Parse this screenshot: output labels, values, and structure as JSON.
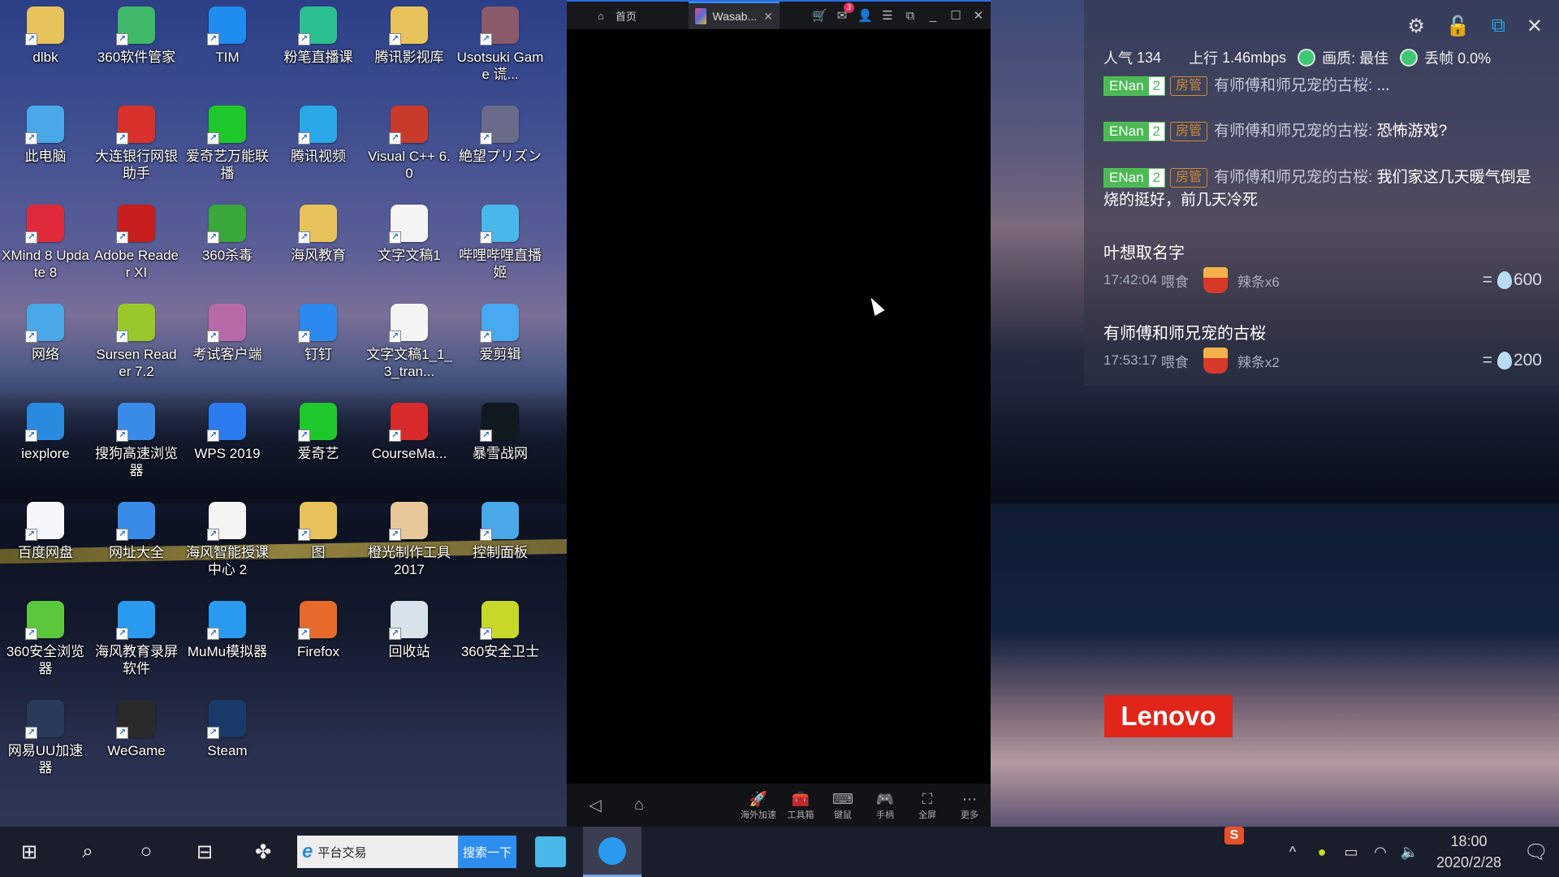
{
  "desktop": {
    "icons": [
      {
        "label": "dlbk",
        "icon": "user-folder-icon",
        "color": "#e8c25a"
      },
      {
        "label": "360软件管家",
        "icon": "360-software-manager-icon",
        "color": "#3fb86a"
      },
      {
        "label": "TIM",
        "icon": "tim-icon",
        "color": "#1f8cf0"
      },
      {
        "label": "粉笔直播课",
        "icon": "fenbi-icon",
        "color": "#2cbf8f"
      },
      {
        "label": "腾讯影视库",
        "icon": "tencent-video-library-icon",
        "color": "#e8c25a"
      },
      {
        "label": "Usotsuki Game 谎...",
        "icon": "usotsuki-game-icon",
        "color": "#8a5a6a"
      },
      {
        "label": "此电脑",
        "icon": "this-pc-icon",
        "color": "#48a8e8"
      },
      {
        "label": "大连银行网银助手",
        "icon": "dalian-bank-icon",
        "color": "#d8302a"
      },
      {
        "label": "爱奇艺万能联播",
        "icon": "iqiyi-lianbo-icon",
        "color": "#1fc82a"
      },
      {
        "label": "腾讯视频",
        "icon": "tencent-video-icon",
        "color": "#2aa8e8"
      },
      {
        "label": "Visual C++ 6.0",
        "icon": "visual-cpp-icon",
        "color": "#c83a2a"
      },
      {
        "label": "絶望プリズン",
        "icon": "zetsubou-prison-icon",
        "color": "#6a6a8a"
      },
      {
        "label": "XMind 8 Update 8",
        "icon": "xmind-icon",
        "color": "#e02a3a"
      },
      {
        "label": "Adobe Reader XI",
        "icon": "adobe-reader-icon",
        "color": "#c81e1e"
      },
      {
        "label": "360杀毒",
        "icon": "360-antivirus-icon",
        "color": "#3aa83a"
      },
      {
        "label": "海风教育",
        "icon": "folder-icon",
        "color": "#e8c25a"
      },
      {
        "label": "文字文稿1",
        "icon": "wps-document-icon",
        "color": "#f4f4f4"
      },
      {
        "label": "哔哩哔哩直播姬",
        "icon": "bilibili-live-icon",
        "color": "#48b8e8"
      },
      {
        "label": "网络",
        "icon": "network-icon",
        "color": "#48a8e8"
      },
      {
        "label": "Sursen Reader 7.2",
        "icon": "sursen-reader-icon",
        "color": "#9ac82a"
      },
      {
        "label": "考试客户端",
        "icon": "exam-client-icon",
        "color": "#b86aa8"
      },
      {
        "label": "钉钉",
        "icon": "dingtalk-icon",
        "color": "#2a8af0"
      },
      {
        "label": "文字文稿1_1_3_tran...",
        "icon": "wps-document-icon",
        "color": "#f4f4f4"
      },
      {
        "label": "爱剪辑",
        "icon": "aijianji-icon",
        "color": "#48a8f0"
      },
      {
        "label": "iexplore",
        "icon": "internet-explorer-icon",
        "color": "#2a8ae0"
      },
      {
        "label": "搜狗高速浏览器",
        "icon": "sogou-browser-icon",
        "color": "#3a8ae8"
      },
      {
        "label": "WPS 2019",
        "icon": "wps-icon",
        "color": "#2a7af0"
      },
      {
        "label": "爱奇艺",
        "icon": "iqiyi-icon",
        "color": "#1fc82a"
      },
      {
        "label": "CourseMa...",
        "icon": "coursemaker-icon",
        "color": "#d82a2a"
      },
      {
        "label": "暴雪战网",
        "icon": "battle-net-icon",
        "color": "#101820"
      },
      {
        "label": "百度网盘",
        "icon": "baidu-netdisk-icon",
        "color": "#f4f8fc"
      },
      {
        "label": "网址大全",
        "icon": "url-navigator-icon",
        "color": "#3a8ae8"
      },
      {
        "label": "海风智能授课中心 2",
        "icon": "blank-file-icon",
        "color": "#f4f4f4"
      },
      {
        "label": "图",
        "icon": "folder-icon",
        "color": "#e8c25a"
      },
      {
        "label": "橙光制作工具2017",
        "icon": "orange-light-tool-icon",
        "color": "#e8c89a"
      },
      {
        "label": "控制面板",
        "icon": "control-panel-icon",
        "color": "#48a8e8"
      },
      {
        "label": "360安全浏览器",
        "icon": "360-browser-icon",
        "color": "#5ac83a"
      },
      {
        "label": "海风教育录屏软件",
        "icon": "screen-recorder-icon",
        "color": "#2a9af0"
      },
      {
        "label": "MuMu模拟器",
        "icon": "mumu-emulator-icon",
        "color": "#2a9af0"
      },
      {
        "label": "Firefox",
        "icon": "firefox-icon",
        "color": "#e86a2a"
      },
      {
        "label": "回收站",
        "icon": "recycle-bin-icon",
        "color": "#d8e4ec"
      },
      {
        "label": "360安全卫士",
        "icon": "360-security-icon",
        "color": "#c8d82a"
      },
      {
        "label": "网易UU加速器",
        "icon": "uu-accelerator-icon",
        "color": "#2a3a5a"
      },
      {
        "label": "WeGame",
        "icon": "wegame-icon",
        "color": "#2a2a2a"
      },
      {
        "label": "Steam",
        "icon": "steam-icon",
        "color": "#1a3a6a"
      }
    ]
  },
  "emulator": {
    "home_tab": "首页",
    "active_tab": "Wasab...",
    "mail_badge": "3",
    "nav": {
      "back": "◁",
      "home": "⌂"
    },
    "tools": [
      {
        "label": "海外加速",
        "icon": "rocket-icon",
        "glyph": "🚀"
      },
      {
        "label": "工具箱",
        "icon": "toolbox-icon",
        "glyph": "🧰"
      },
      {
        "label": "键鼠",
        "icon": "keyboard-icon",
        "glyph": "⌨"
      },
      {
        "label": "手柄",
        "icon": "gamepad-icon",
        "glyph": "🎮"
      },
      {
        "label": "全屏",
        "icon": "fullscreen-icon",
        "glyph": "⛶"
      },
      {
        "label": "更多",
        "icon": "more-icon",
        "glyph": "⋯"
      }
    ]
  },
  "live_panel": {
    "stats": {
      "popularity_label": "人气",
      "popularity": "134",
      "upload_label": "上行",
      "upload": "1.46mbps",
      "quality": "画质: 最佳",
      "dropped": "丢帧 0.0%",
      "status_color": "#3ec876"
    },
    "chat": [
      {
        "medal": "ENan",
        "level": "2",
        "role": "房管",
        "user": "有师傅和师兄宠的古桜:",
        "text": "..."
      },
      {
        "medal": "ENan",
        "level": "2",
        "role": "房管",
        "user": "有师傅和师兄宠的古桜:",
        "text": "恐怖游戏?"
      },
      {
        "medal": "ENan",
        "level": "2",
        "role": "房管",
        "user": "有师傅和师兄宠的古桜:",
        "text": "我们家这几天暖气倒是烧的挺好，前几天冷死"
      }
    ],
    "gifts": [
      {
        "user": "叶想取名字",
        "time": "17:42:04",
        "action": "喂食",
        "gift": "辣条x6",
        "value": "600"
      },
      {
        "user": "有师傅和师兄宠的古桜",
        "time": "17:53:17",
        "action": "喂食",
        "gift": "辣条x2",
        "value": "200"
      }
    ],
    "equals": "="
  },
  "wallpaper": {
    "brand": "Lenovo",
    "brand_color": "#e1251b"
  },
  "taskbar": {
    "search_text": "平台交易",
    "search_button": "搜索一下",
    "time": "18:00",
    "date": "2020/2/28",
    "ime": "S"
  }
}
